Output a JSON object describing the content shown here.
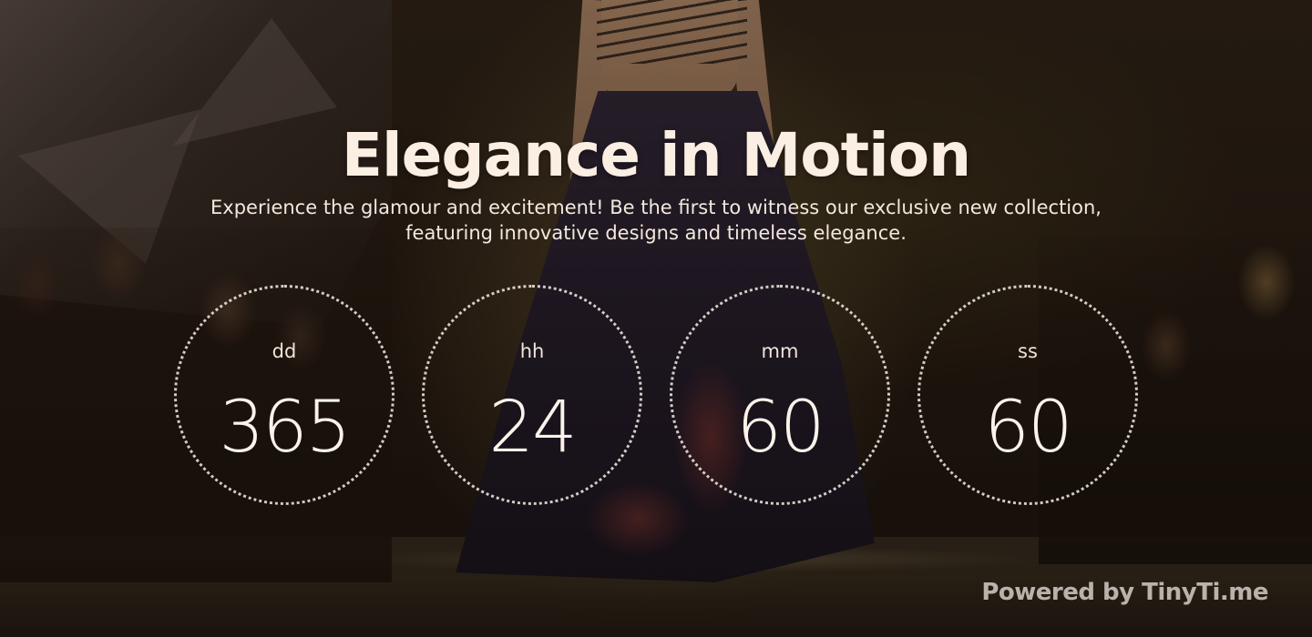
{
  "hero": {
    "title": "Elegance in Motion",
    "subtitle": "Experience the glamour and excitement! Be the first to witness our exclusive new collection, featuring innovative designs and timeless elegance."
  },
  "countdown": {
    "units": [
      {
        "label": "dd",
        "value": "365"
      },
      {
        "label": "hh",
        "value": "24"
      },
      {
        "label": "mm",
        "value": "60"
      },
      {
        "label": "ss",
        "value": "60"
      }
    ]
  },
  "footer": {
    "powered_by": "Powered by TinyTi.me"
  },
  "colors": {
    "text_primary": "#fbeee3",
    "ring": "#f5eee6",
    "watermark": "#e6ded6"
  }
}
